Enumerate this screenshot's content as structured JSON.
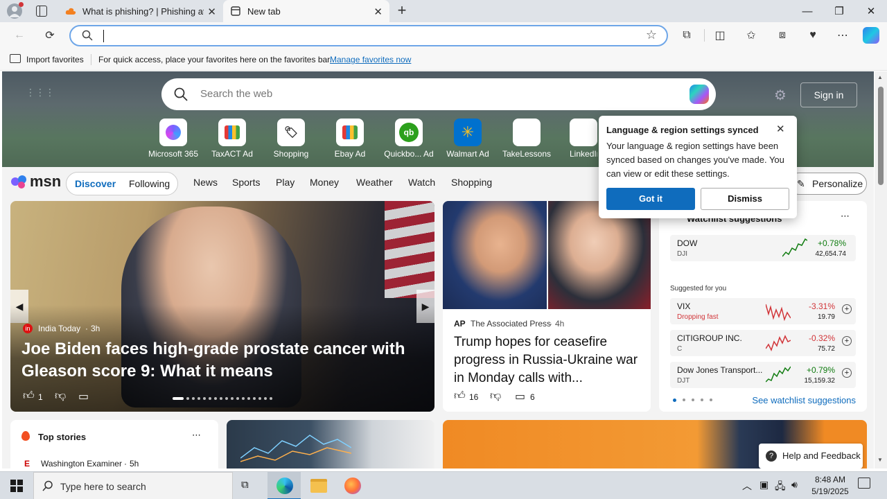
{
  "browser": {
    "tabs": [
      {
        "title": "What is phishing? | Phishing atta"
      },
      {
        "title": "New tab"
      }
    ],
    "favorites_bar": {
      "import_label": "Import favorites",
      "hint": "For quick access, place your favorites here on the favorites bar.",
      "manage_link": "Manage favorites now"
    }
  },
  "msn": {
    "search_placeholder": "Search the web",
    "sign_in": "Sign in",
    "quick_links": [
      {
        "label": "Microsoft 365",
        "ad": ""
      },
      {
        "label": "TaxACT",
        "ad": "Ad"
      },
      {
        "label": "Shopping",
        "ad": ""
      },
      {
        "label": "Ebay",
        "ad": "Ad"
      },
      {
        "label": "Quickbo...",
        "ad": "Ad"
      },
      {
        "label": "Walmart",
        "ad": "Ad"
      },
      {
        "label": "TakeLessons",
        "ad": ""
      },
      {
        "label": "LinkedIn",
        "ad": ""
      }
    ],
    "logo": "msn",
    "nav": {
      "discover": "Discover",
      "following": "Following",
      "items": [
        "News",
        "Sports",
        "Play",
        "Money",
        "Weather",
        "Watch",
        "Shopping"
      ],
      "personalize": "Personalize"
    },
    "hero_story": {
      "source": "India Today",
      "age": "3h",
      "headline": "Joe Biden faces high-grade prostate cancer with Gleason score 9: What it means",
      "likes": "1"
    },
    "second_story": {
      "source": "The Associated Press",
      "age": "4h",
      "headline": "Trump hopes for ceasefire progress in Russia-Ukraine war in Monday calls with...",
      "likes": "16",
      "comments": "6"
    },
    "watchlist": {
      "title": "Watchlist suggestions",
      "suggested_label": "Suggested for you",
      "see_more": "See watchlist suggestions",
      "featured": {
        "name": "DOW",
        "symbol": "DJI",
        "change": "+0.78%",
        "price": "42,654.74"
      },
      "suggested": [
        {
          "name": "VIX",
          "symbol": "Dropping fast",
          "change": "-3.31%",
          "price": "19.79"
        },
        {
          "name": "CITIGROUP INC.",
          "symbol": "C",
          "change": "-0.32%",
          "price": "75.72"
        },
        {
          "name": "Dow Jones Transport...",
          "symbol": "DJT",
          "change": "+0.79%",
          "price": "15,159.32"
        }
      ]
    },
    "top_stories": {
      "title": "Top stories",
      "source": "Washington Examiner",
      "age": "5h"
    },
    "help_feedback": "Help and Feedback"
  },
  "popup": {
    "title": "Language & region settings synced",
    "body": "Your language & region settings have been synced based on changes you've made. You can view or edit these settings.",
    "got_it": "Got it",
    "dismiss": "Dismiss"
  },
  "taskbar": {
    "search_placeholder": "Type here to search",
    "time": "8:48 AM",
    "date": "5/19/2025"
  },
  "colors": {
    "accent": "#0f6cbd",
    "gain": "#107c10",
    "loss": "#d13438"
  }
}
